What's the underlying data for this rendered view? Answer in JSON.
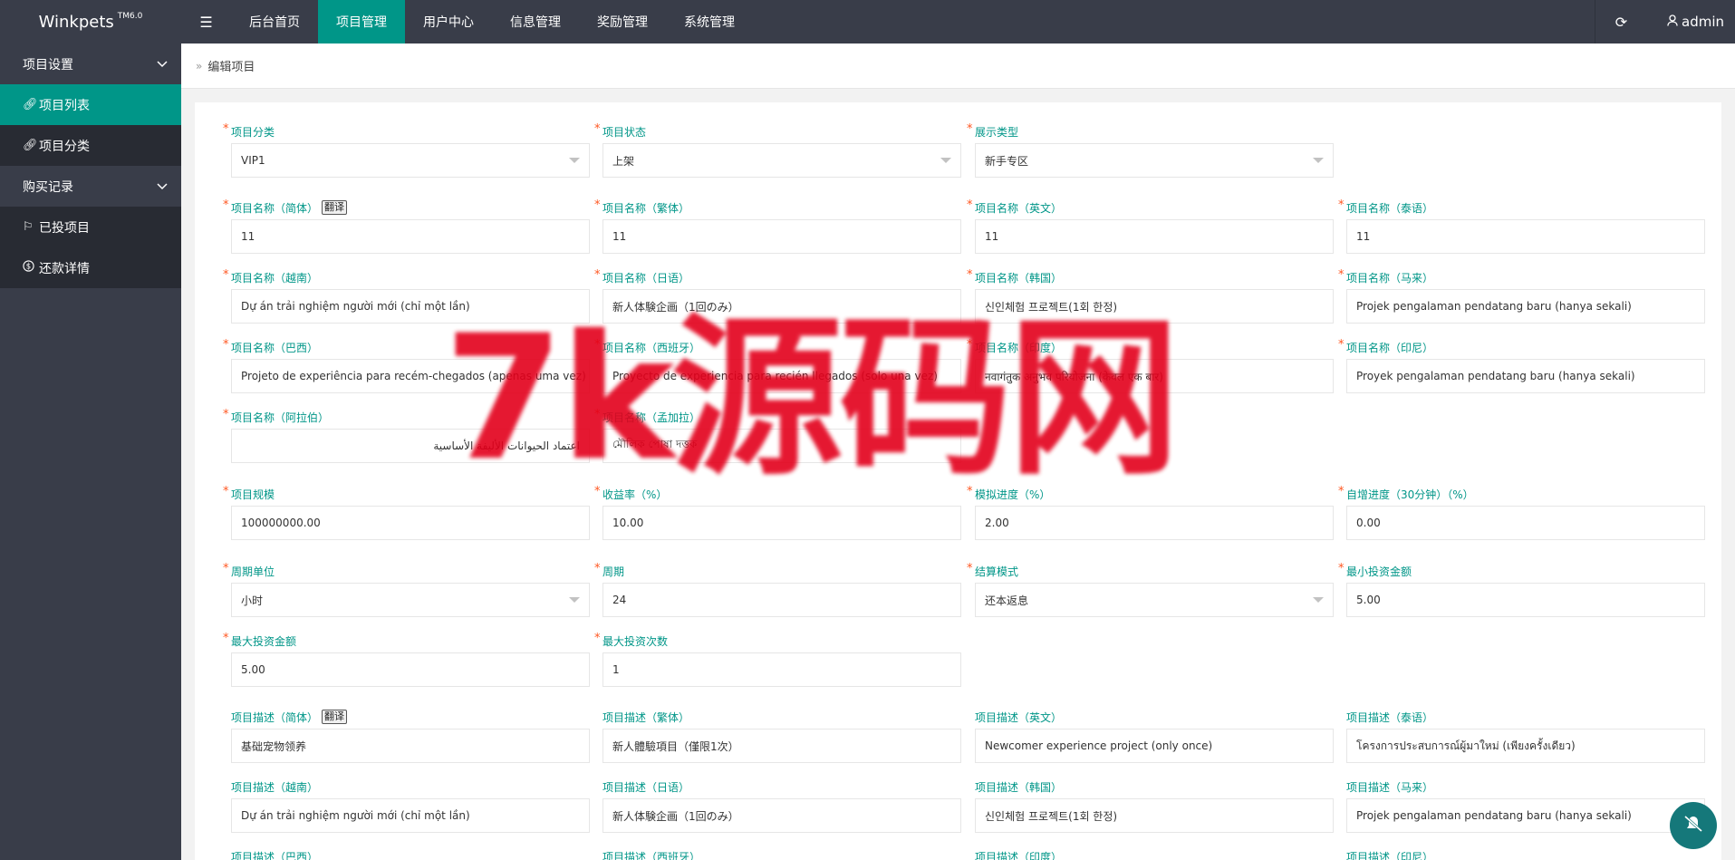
{
  "app": {
    "name": "Winkpets",
    "version": "TM6.0"
  },
  "topnav": [
    {
      "label": "后台首页",
      "active": false
    },
    {
      "label": "项目管理",
      "active": true
    },
    {
      "label": "用户中心",
      "active": false
    },
    {
      "label": "信息管理",
      "active": false
    },
    {
      "label": "奖励管理",
      "active": false
    },
    {
      "label": "系统管理",
      "active": false
    }
  ],
  "user": {
    "name": "admin"
  },
  "sidebar": {
    "group1": "项目设置",
    "item_list": "项目列表",
    "item_category": "项目分类",
    "group2": "购买记录",
    "item_invested": "已投项目",
    "item_repay": "还款详情"
  },
  "breadcrumb": "编辑项目",
  "translate_label": "翻译",
  "form": {
    "category": {
      "label": "项目分类",
      "value": "VIP1"
    },
    "status": {
      "label": "项目状态",
      "value": "上架"
    },
    "display_type": {
      "label": "展示类型",
      "value": "新手专区"
    },
    "name_zh": {
      "label": "项目名称（简体）",
      "value": "11"
    },
    "name_tw": {
      "label": "项目名称（繁体）",
      "value": "11"
    },
    "name_en": {
      "label": "项目名称（英文）",
      "value": "11"
    },
    "name_th": {
      "label": "项目名称（泰语）",
      "value": "11"
    },
    "name_vi": {
      "label": "项目名称（越南）",
      "value": "Dự án trải nghiệm người mới (chỉ một lần)"
    },
    "name_ja": {
      "label": "项目名称（日语）",
      "value": "新人体験企画（1回のみ）"
    },
    "name_ko": {
      "label": "项目名称（韩国）",
      "value": "신인체험 프로젝트(1회 한정)"
    },
    "name_ms": {
      "label": "项目名称（马来）",
      "value": "Projek pengalaman pendatang baru (hanya sekali)"
    },
    "name_pt": {
      "label": "项目名称（巴西）",
      "value": "Projeto de experiência para recém-chegados (apenas uma vez)"
    },
    "name_es": {
      "label": "项目名称（西班牙）",
      "value": "Proyecto de experiencia para recién llegados (solo una vez)"
    },
    "name_hi": {
      "label": "项目名称（印度）",
      "value": "नवागंतुक अनुभव परियोजना (केवल एक बार)"
    },
    "name_id": {
      "label": "项目名称（印尼）",
      "value": "Proyek pengalaman pendatang baru (hanya sekali)"
    },
    "name_ar": {
      "label": "项目名称（阿拉伯）",
      "value": "اعتماد الحيوانات الأليفة الأساسية"
    },
    "name_bn": {
      "label": "项目名称（孟加拉）",
      "value": "মৌলিক পোষা দত্তক"
    },
    "scale": {
      "label": "项目规模",
      "value": "100000000.00"
    },
    "yield": {
      "label": "收益率（%）",
      "value": "10.00"
    },
    "sim_progress": {
      "label": "模拟进度（%）",
      "value": "2.00"
    },
    "auto_progress": {
      "label": "自增进度（30分钟）（%）",
      "value": "0.00"
    },
    "period_unit": {
      "label": "周期单位",
      "value": "小时"
    },
    "period": {
      "label": "周期",
      "value": "24"
    },
    "settle_mode": {
      "label": "结算模式",
      "value": "还本返息"
    },
    "min_invest": {
      "label": "最小投资金额",
      "value": "5.00"
    },
    "max_invest": {
      "label": "最大投资金额",
      "value": "5.00"
    },
    "max_times": {
      "label": "最大投资次数",
      "value": "1"
    },
    "desc_zh": {
      "label": "项目描述（简体）",
      "value": "基础宠物领养"
    },
    "desc_tw": {
      "label": "项目描述（繁体）",
      "value": "新人體驗項目（僅限1次）"
    },
    "desc_en": {
      "label": "项目描述（英文）",
      "value": "Newcomer experience project (only once)"
    },
    "desc_th": {
      "label": "项目描述（泰语）",
      "value": "โครงการประสบการณ์ผู้มาใหม่ (เพียงครั้งเดียว)"
    },
    "desc_vi": {
      "label": "项目描述（越南）",
      "value": "Dự án trải nghiệm người mới (chỉ một lần)"
    },
    "desc_ja": {
      "label": "项目描述（日语）",
      "value": "新人体験企画（1回のみ）"
    },
    "desc_ko": {
      "label": "项目描述（韩国）",
      "value": "신인체험 프로젝트(1회 한정)"
    },
    "desc_ms": {
      "label": "项目描述（马来）",
      "value": "Projek pengalaman pendatang baru (hanya sekali)"
    },
    "desc_pt": {
      "label": "项目描述（巴西）"
    },
    "desc_es": {
      "label": "项目描述（西班牙）"
    },
    "desc_hi": {
      "label": "项目描述（印度）"
    },
    "desc_id": {
      "label": "项目描述（印尼）"
    }
  },
  "watermark": "7k源码网",
  "colors": {
    "accent": "#009688",
    "topbar": "#393d49",
    "sidebar_item": "#282b33",
    "required": "#ff5722",
    "watermark": "#e3001b"
  }
}
